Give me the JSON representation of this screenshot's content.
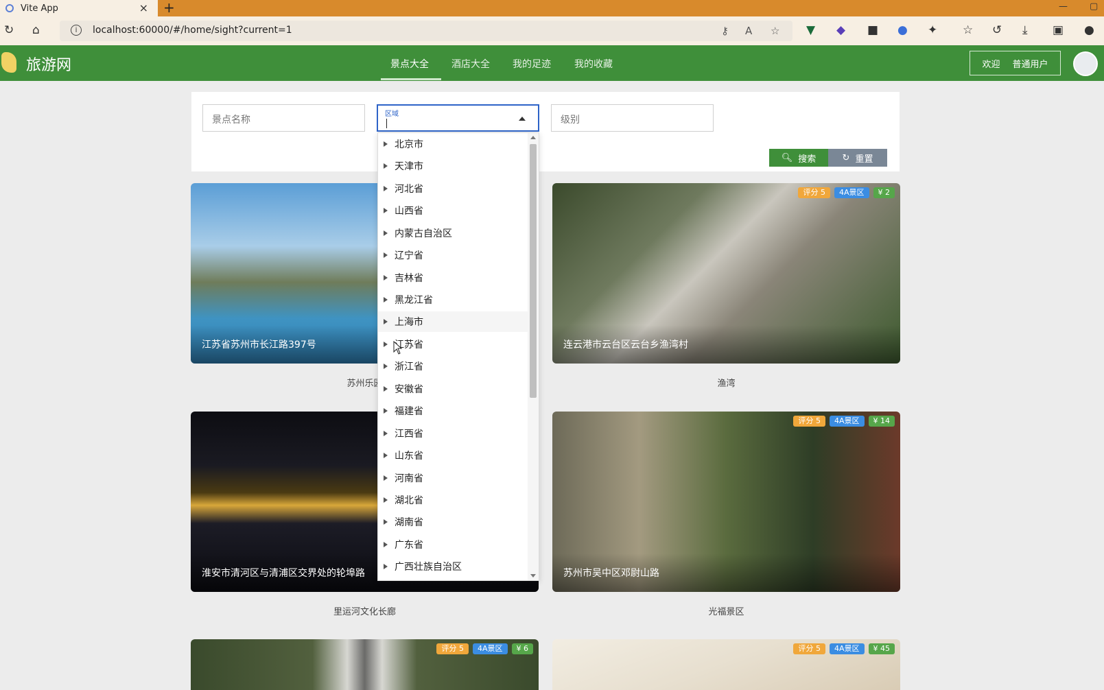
{
  "browser": {
    "tab_title": "Vite App",
    "tab_close": "×",
    "new_tab": "+",
    "url": "localhost:60000/#/home/sight?current=1",
    "icons": [
      "refresh-icon",
      "home-icon",
      "info-icon",
      "key-icon",
      "read-aloud-icon",
      "favorite-add-icon",
      "extension-v-icon",
      "extension-badge-icon",
      "extension-mask-icon",
      "extension-blue-icon",
      "extensions-icon",
      "favorites-icon",
      "history-icon",
      "download-icon",
      "collections-icon",
      "profile-icon"
    ]
  },
  "header": {
    "brand": "旅游网",
    "nav": [
      {
        "label": "景点大全",
        "active": true
      },
      {
        "label": "酒店大全",
        "active": false
      },
      {
        "label": "我的足迹",
        "active": false
      },
      {
        "label": "我的收藏",
        "active": false
      }
    ],
    "welcome": "欢迎",
    "user": "普通用户"
  },
  "search": {
    "name_placeholder": "景点名称",
    "region_label": "区域",
    "level_placeholder": "级别",
    "search_button": "搜索",
    "reset_button": "重置"
  },
  "region_options": [
    "北京市",
    "天津市",
    "河北省",
    "山西省",
    "内蒙古自治区",
    "辽宁省",
    "吉林省",
    "黑龙江省",
    "上海市",
    "江苏省",
    "浙江省",
    "安徽省",
    "福建省",
    "江西省",
    "山东省",
    "河南省",
    "湖北省",
    "湖南省",
    "广东省",
    "广西壮族自治区"
  ],
  "cards": [
    {
      "address": "江苏省苏州市长江路397号",
      "title": "苏州乐园",
      "rating": "",
      "level": "",
      "price": ""
    },
    {
      "address": "连云港市云台区云台乡渔湾村",
      "title": "渔湾",
      "rating": "评分 5",
      "level": "4A景区",
      "price": "¥ 2"
    },
    {
      "address": "淮安市清河区与清浦区交界处的轮埠路",
      "title": "里运河文化长廊",
      "rating": "",
      "level": "",
      "price": ""
    },
    {
      "address": "苏州市吴中区邓尉山路",
      "title": "光福景区",
      "rating": "评分 5",
      "level": "4A景区",
      "price": "¥ 14"
    },
    {
      "address": "",
      "title": "",
      "rating": "评分 5",
      "level": "4A景区",
      "price": "¥ 6"
    },
    {
      "address": "",
      "title": "",
      "rating": "评分 5",
      "level": "4A景区",
      "price": "¥ 45"
    }
  ],
  "colors": {
    "primary": "#3f8f3a",
    "tab_bar": "#d88a2c",
    "focus": "#2d63c8"
  }
}
